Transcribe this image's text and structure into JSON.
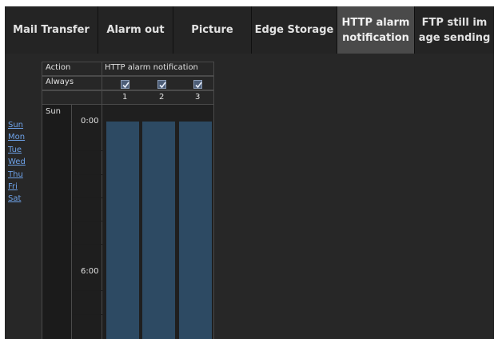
{
  "tabs": [
    {
      "label": "Mail Transfer",
      "active": false
    },
    {
      "label": "Alarm out",
      "active": false
    },
    {
      "label": "Picture",
      "active": false
    },
    {
      "label": "Edge Storage",
      "active": false
    },
    {
      "label": "HTTP alarm\nnotification",
      "active": true
    },
    {
      "label": "FTP still im\nage sending",
      "active": false
    }
  ],
  "days": [
    "Sun",
    "Mon",
    "Tue",
    "Wed",
    "Thu",
    "Fri",
    "Sat"
  ],
  "schedule": {
    "action_label": "Action",
    "action_value": "HTTP alarm notification",
    "always_label": "Always",
    "always_checked": [
      true,
      true,
      true
    ],
    "columns": [
      "1",
      "2",
      "3"
    ],
    "day": "Sun",
    "times": [
      "0:00",
      "6:00"
    ]
  },
  "colors": {
    "active_tab": "#4a4a4a",
    "slot_fill": "#2d4a63",
    "day_link": "#6ea2e8",
    "checkbox_fill": "#4d5e78"
  }
}
